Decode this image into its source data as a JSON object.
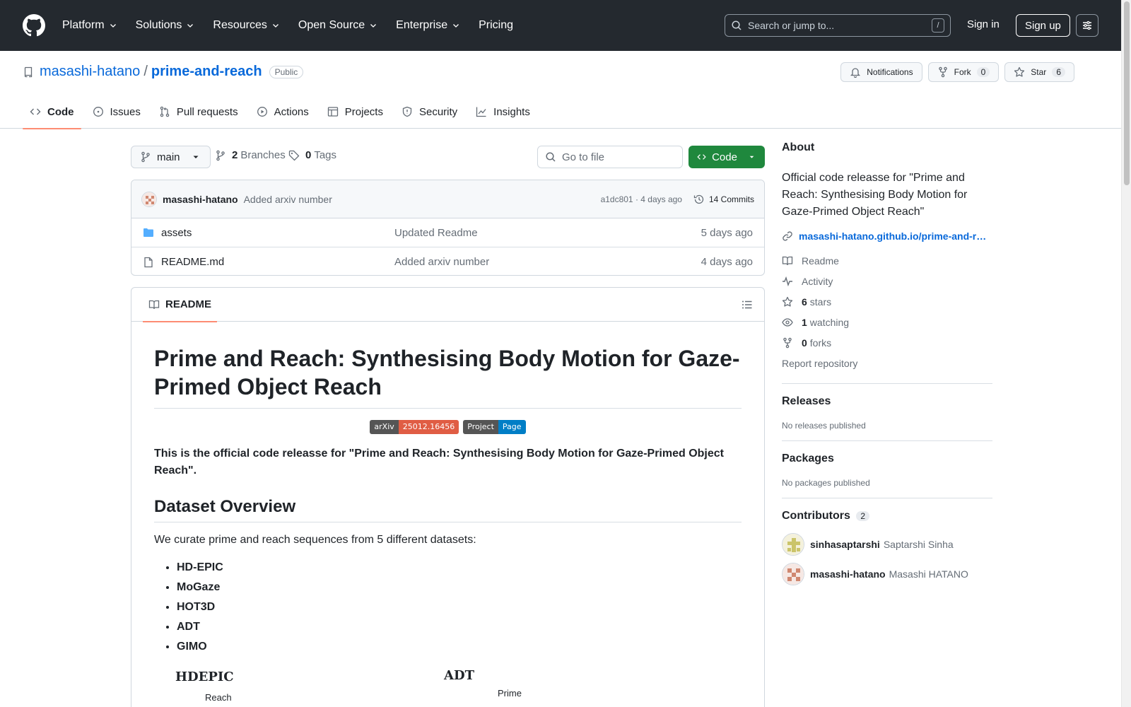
{
  "header": {
    "nav": [
      {
        "label": "Platform",
        "dropdown": true
      },
      {
        "label": "Solutions",
        "dropdown": true
      },
      {
        "label": "Resources",
        "dropdown": true
      },
      {
        "label": "Open Source",
        "dropdown": true
      },
      {
        "label": "Enterprise",
        "dropdown": true
      },
      {
        "label": "Pricing",
        "dropdown": false
      }
    ],
    "search_placeholder": "Search or jump to...",
    "search_key": "/",
    "sign_in": "Sign in",
    "sign_up": "Sign up"
  },
  "repo": {
    "owner": "masashi-hatano",
    "separator": "/",
    "name": "prime-and-reach",
    "visibility": "Public",
    "notifications_label": "Notifications",
    "fork_label": "Fork",
    "fork_count": "0",
    "star_label": "Star",
    "star_count": "6",
    "tabs": [
      "Code",
      "Issues",
      "Pull requests",
      "Actions",
      "Projects",
      "Security",
      "Insights"
    ]
  },
  "filenav": {
    "branch": "main",
    "branches_count": "2",
    "branches_label": "Branches",
    "tags_count": "0",
    "tags_label": "Tags",
    "goto_placeholder": "Go to file",
    "code_button": "Code"
  },
  "commit": {
    "author": "masashi-hatano",
    "message": "Added arxiv number",
    "hash_time": "a1dc801 · 4 days ago",
    "commits": "14 Commits"
  },
  "files": [
    {
      "name": "assets",
      "type": "folder",
      "message": "Updated Readme",
      "date": "5 days ago"
    },
    {
      "name": "README.md",
      "type": "file",
      "message": "Added arxiv number",
      "date": "4 days ago"
    }
  ],
  "readme": {
    "tab_label": "README",
    "title": "Prime and Reach: Synthesising Body Motion for Gaze-Primed Object Reach",
    "badges": [
      {
        "left": "arXiv",
        "right": "25012.16456",
        "color": "#e05d44"
      },
      {
        "left": "Project",
        "right": "Page",
        "color": "#007ec6"
      }
    ],
    "lead": "This is the official code releasse for \"Prime and Reach: Synthesising Body Motion for Gaze-Primed Object Reach\".",
    "h2": "Dataset Overview",
    "intro": "We curate prime and reach sequences from 5 different datasets:",
    "datasets": [
      "HD-EPIC",
      "MoGaze",
      "HOT3D",
      "ADT",
      "GIMO"
    ],
    "figure_labels": {
      "left": "HDEPIC",
      "right": "ADT",
      "left_sub": "Reach",
      "right_sub": "Prime"
    }
  },
  "about": {
    "heading": "About",
    "description": "Official code releasse for \"Prime and Reach: Synthesising Body Motion for Gaze-Primed Object Reach\"",
    "link": "masashi-hatano.github.io/prime-and-r…",
    "readme": "Readme",
    "activity": "Activity",
    "stars_count": "6",
    "stars_label": "stars",
    "watching_count": "1",
    "watching_label": "watching",
    "forks_count": "0",
    "forks_label": "forks",
    "report": "Report repository"
  },
  "releases": {
    "heading": "Releases",
    "empty": "No releases published"
  },
  "packages": {
    "heading": "Packages",
    "empty": "No packages published"
  },
  "contributors": {
    "heading": "Contributors",
    "count": "2",
    "list": [
      {
        "login": "sinhasaptarshi",
        "name": "Saptarshi Sinha"
      },
      {
        "login": "masashi-hatano",
        "name": "Masashi HATANO"
      }
    ]
  },
  "colors": {
    "header_bg": "#24292f",
    "accent_link": "#0969da",
    "code_button": "#1f883d",
    "tab_underline": "#fd8c73"
  }
}
